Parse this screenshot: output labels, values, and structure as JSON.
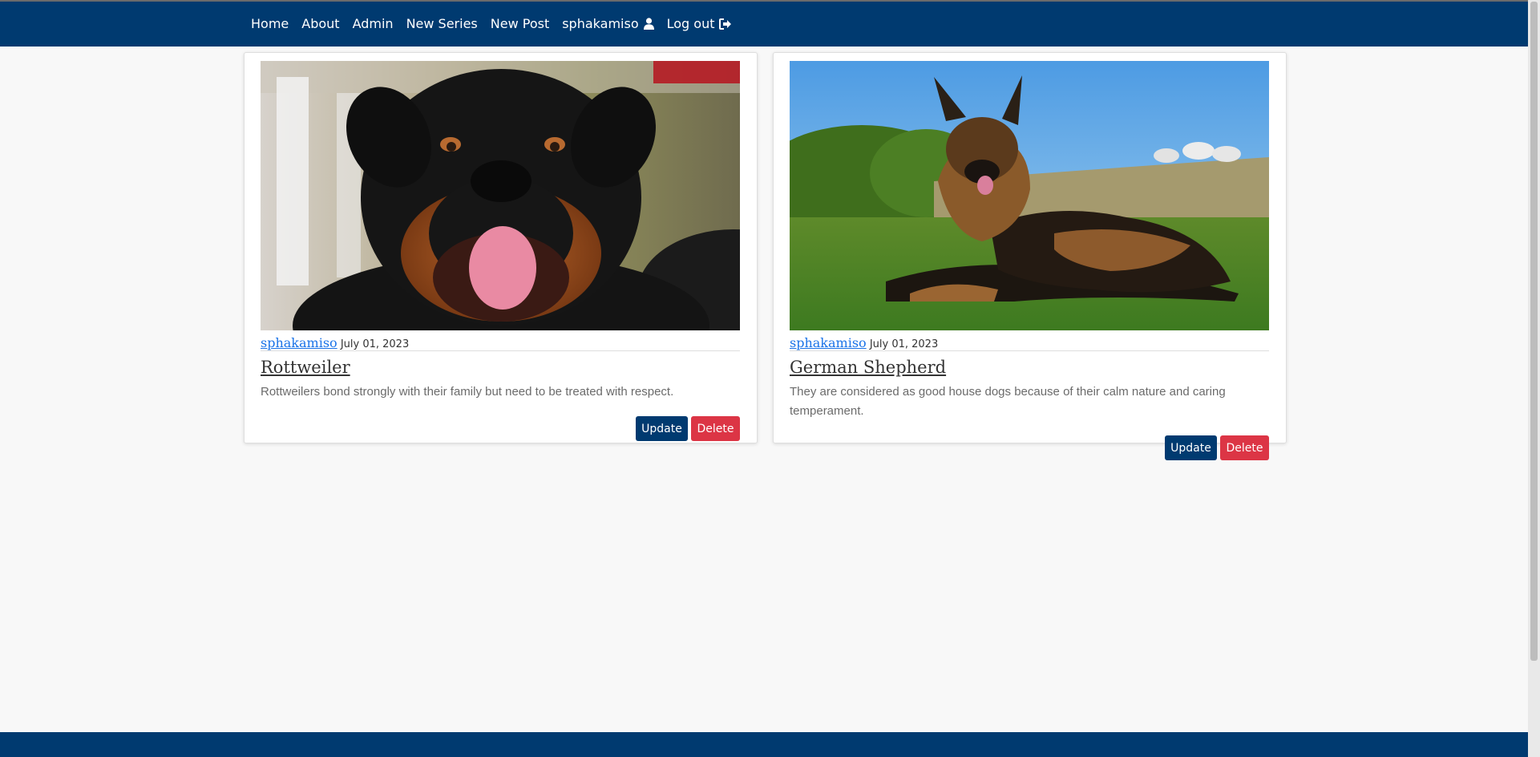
{
  "nav": {
    "items": [
      "Home",
      "About",
      "Admin",
      "New Series",
      "New Post"
    ],
    "user": "sphakamiso",
    "logout": "Log out",
    "user_icon": "user-icon",
    "logout_icon": "sign-out-icon"
  },
  "posts": [
    {
      "image": "rottweiler-photo",
      "author": "sphakamiso",
      "date": "July 01, 2023",
      "title": "Rottweiler",
      "description": "Rottweilers bond strongly with their family but need to be treated with respect.",
      "update": "Update",
      "delete": "Delete"
    },
    {
      "image": "german-shepherd-photo",
      "author": "sphakamiso",
      "date": "July 01, 2023",
      "title": "German Shepherd",
      "description": "They are considered as good house dogs because of their calm nature and caring temperament.",
      "update": "Update",
      "delete": "Delete"
    }
  ],
  "colors": {
    "navbar": "#003a70",
    "primary_button": "#003a70",
    "danger_button": "#dc3545",
    "link": "#1a73e8",
    "page_background": "#f8f8f8"
  }
}
